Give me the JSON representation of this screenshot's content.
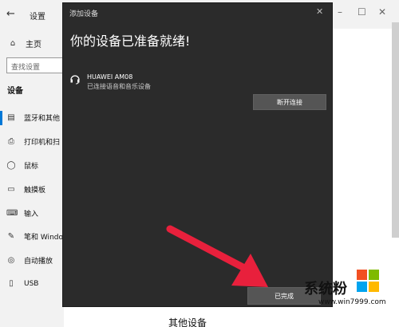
{
  "settings": {
    "window_title": "设置",
    "home_label": "主页",
    "search_placeholder": "查找设置",
    "section_title": "设备",
    "nav_items": [
      {
        "label": "蓝牙和其他",
        "icon": "bluetooth-icon"
      },
      {
        "label": "打印机和扫",
        "icon": "printer-icon"
      },
      {
        "label": "鼠标",
        "icon": "mouse-icon"
      },
      {
        "label": "触摸板",
        "icon": "touchpad-icon"
      },
      {
        "label": "输入",
        "icon": "keyboard-icon"
      },
      {
        "label": "笔和 Windo",
        "icon": "pen-icon"
      },
      {
        "label": "自动播放",
        "icon": "autoplay-icon"
      },
      {
        "label": "USB",
        "icon": "usb-icon"
      }
    ],
    "right_heading": "其他设备"
  },
  "dialog": {
    "title": "添加设备",
    "heading": "你的设备已准备就绪!",
    "device_name": "HUAWEI AM08",
    "device_status": "已连接语音和音乐设备",
    "disconnect_label": "断开连接",
    "done_label": "已完成"
  },
  "watermark": {
    "text": "系统粉",
    "url": "www.win7999.com"
  },
  "colors": {
    "accent": "#0078d7",
    "dialog_bg": "#2b2b2b",
    "arrow": "#e8203c"
  }
}
